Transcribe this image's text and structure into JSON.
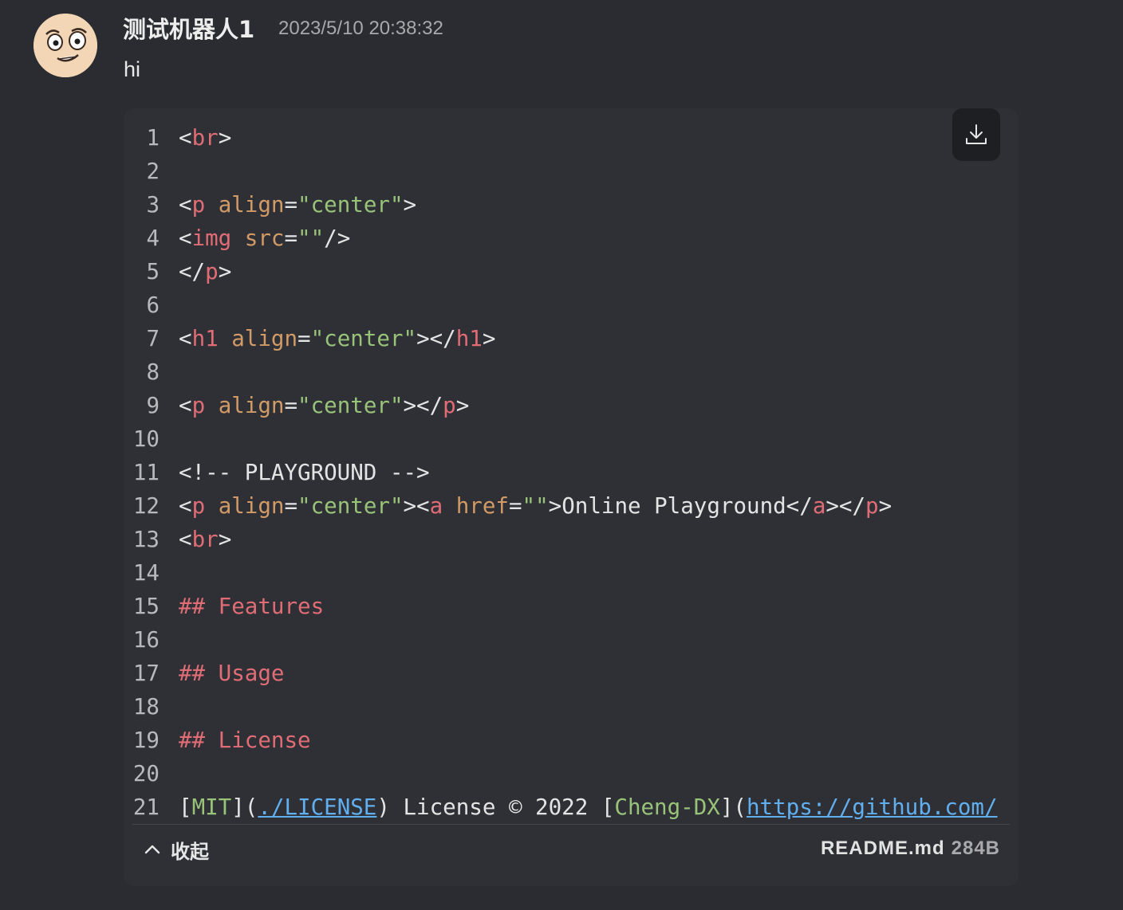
{
  "message": {
    "sender": "测试机器人1",
    "timestamp": "2023/5/10 20:38:32",
    "text": "hi"
  },
  "colors": {
    "punct": "#e4e4e4",
    "tag": "#e06c75",
    "attr": "#d19a66",
    "string": "#98c379",
    "text": "#e4e4e4",
    "link": "#61afef"
  },
  "code": {
    "lines": [
      {
        "n": "1",
        "tokens": [
          {
            "t": "<",
            "c": "punct"
          },
          {
            "t": "br",
            "c": "tag"
          },
          {
            "t": ">",
            "c": "punct"
          }
        ]
      },
      {
        "n": "2",
        "tokens": []
      },
      {
        "n": "3",
        "tokens": [
          {
            "t": "<",
            "c": "punct"
          },
          {
            "t": "p",
            "c": "tag"
          },
          {
            "t": " ",
            "c": "text"
          },
          {
            "t": "align",
            "c": "attr"
          },
          {
            "t": "=",
            "c": "punct"
          },
          {
            "t": "\"center\"",
            "c": "string"
          },
          {
            "t": ">",
            "c": "punct"
          }
        ]
      },
      {
        "n": "4",
        "tokens": [
          {
            "t": "<",
            "c": "punct"
          },
          {
            "t": "img",
            "c": "tag"
          },
          {
            "t": " ",
            "c": "text"
          },
          {
            "t": "src",
            "c": "attr"
          },
          {
            "t": "=",
            "c": "punct"
          },
          {
            "t": "\"\"",
            "c": "string"
          },
          {
            "t": "/>",
            "c": "punct"
          }
        ]
      },
      {
        "n": "5",
        "tokens": [
          {
            "t": "</",
            "c": "punct"
          },
          {
            "t": "p",
            "c": "tag"
          },
          {
            "t": ">",
            "c": "punct"
          }
        ]
      },
      {
        "n": "6",
        "tokens": []
      },
      {
        "n": "7",
        "tokens": [
          {
            "t": "<",
            "c": "punct"
          },
          {
            "t": "h1",
            "c": "tag"
          },
          {
            "t": " ",
            "c": "text"
          },
          {
            "t": "align",
            "c": "attr"
          },
          {
            "t": "=",
            "c": "punct"
          },
          {
            "t": "\"center\"",
            "c": "string"
          },
          {
            "t": "></",
            "c": "punct"
          },
          {
            "t": "h1",
            "c": "tag"
          },
          {
            "t": ">",
            "c": "punct"
          }
        ]
      },
      {
        "n": "8",
        "tokens": []
      },
      {
        "n": "9",
        "tokens": [
          {
            "t": "<",
            "c": "punct"
          },
          {
            "t": "p",
            "c": "tag"
          },
          {
            "t": " ",
            "c": "text"
          },
          {
            "t": "align",
            "c": "attr"
          },
          {
            "t": "=",
            "c": "punct"
          },
          {
            "t": "\"center\"",
            "c": "string"
          },
          {
            "t": "></",
            "c": "punct"
          },
          {
            "t": "p",
            "c": "tag"
          },
          {
            "t": ">",
            "c": "punct"
          }
        ]
      },
      {
        "n": "10",
        "tokens": []
      },
      {
        "n": "11",
        "tokens": [
          {
            "t": "<!-- PLAYGROUND -->",
            "c": "punct"
          }
        ]
      },
      {
        "n": "12",
        "tokens": [
          {
            "t": "<",
            "c": "punct"
          },
          {
            "t": "p",
            "c": "tag"
          },
          {
            "t": " ",
            "c": "text"
          },
          {
            "t": "align",
            "c": "attr"
          },
          {
            "t": "=",
            "c": "punct"
          },
          {
            "t": "\"center\"",
            "c": "string"
          },
          {
            "t": "><",
            "c": "punct"
          },
          {
            "t": "a",
            "c": "tag"
          },
          {
            "t": " ",
            "c": "text"
          },
          {
            "t": "href",
            "c": "attr"
          },
          {
            "t": "=",
            "c": "punct"
          },
          {
            "t": "\"\"",
            "c": "string"
          },
          {
            "t": ">Online Playground</",
            "c": "punct"
          },
          {
            "t": "a",
            "c": "tag"
          },
          {
            "t": "></",
            "c": "punct"
          },
          {
            "t": "p",
            "c": "tag"
          },
          {
            "t": ">",
            "c": "punct"
          }
        ]
      },
      {
        "n": "13",
        "tokens": [
          {
            "t": "<",
            "c": "punct"
          },
          {
            "t": "br",
            "c": "tag"
          },
          {
            "t": ">",
            "c": "punct"
          }
        ]
      },
      {
        "n": "14",
        "tokens": []
      },
      {
        "n": "15",
        "tokens": [
          {
            "t": "## Features",
            "c": "tag"
          }
        ]
      },
      {
        "n": "16",
        "tokens": []
      },
      {
        "n": "17",
        "tokens": [
          {
            "t": "## Usage",
            "c": "tag"
          }
        ]
      },
      {
        "n": "18",
        "tokens": []
      },
      {
        "n": "19",
        "tokens": [
          {
            "t": "## License",
            "c": "tag"
          }
        ]
      },
      {
        "n": "20",
        "tokens": []
      },
      {
        "n": "21",
        "tokens": [
          {
            "t": "[",
            "c": "punct"
          },
          {
            "t": "MIT",
            "c": "string"
          },
          {
            "t": "](",
            "c": "punct"
          },
          {
            "t": "./LICENSE",
            "c": "link"
          },
          {
            "t": ") License © 2022 [",
            "c": "punct"
          },
          {
            "t": "Cheng-DX",
            "c": "string"
          },
          {
            "t": "](",
            "c": "punct"
          },
          {
            "t": "https://github.com/",
            "c": "link"
          }
        ]
      }
    ]
  },
  "footer": {
    "collapse_label": "收起",
    "file_name": "README.md",
    "file_size": "284B"
  },
  "icons": {
    "download": "download-icon",
    "collapse": "chevron-up-icon",
    "avatar": "cartoon-face-avatar"
  }
}
